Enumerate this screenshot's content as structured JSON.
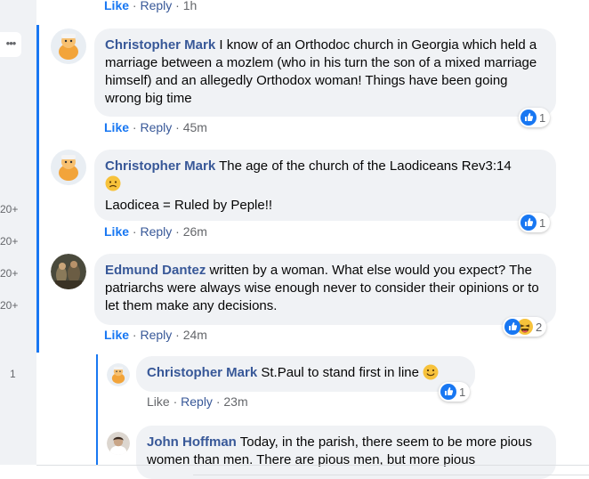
{
  "sidebar": {
    "more_label": "•••",
    "counts": [
      "20+",
      "20+",
      "20+",
      "20+",
      "1"
    ]
  },
  "top_actions": {
    "like": "Like",
    "reply": "Reply",
    "time": "1h"
  },
  "comments": [
    {
      "name": "Christopher Mark",
      "text": "I know of an Orthodoc church in Georgia which held a marriage between a mozlem (who in his turn the son of a mixed marriage himself) and an allegedly Orthodox woman! Things have been going wrong big time",
      "like": "Like",
      "reply": "Reply",
      "time": "45m",
      "reaction_count": "1",
      "reaction_icons": [
        "like-icon"
      ]
    },
    {
      "name": "Christopher Mark",
      "text": "The age of the church of the Laodiceans Rev3:14",
      "text2": "Laodicea = Ruled by Peple!!",
      "emoji": "sad-face-emoji",
      "like": "Like",
      "reply": "Reply",
      "time": "26m",
      "reaction_count": "1",
      "reaction_icons": [
        "like-icon"
      ]
    },
    {
      "name": "Edmund Dantez",
      "text": "written by a woman. What else would you expect? The patriarchs were always wise enough never to consider their opinions or to let them make any decisions.",
      "like": "Like",
      "reply": "Reply",
      "time": "24m",
      "reaction_count": "2",
      "reaction_icons": [
        "like-icon",
        "laugh-icon"
      ]
    }
  ],
  "replies": [
    {
      "name": "Christopher Mark",
      "text": "St.Paul to stand first in line",
      "emoji": "smile-emoji",
      "like": "Like",
      "reply": "Reply",
      "time": "23m",
      "reaction_count": "1",
      "reaction_icons": [
        "like-icon"
      ]
    },
    {
      "name": "John Hoffman",
      "text": "Today, in the parish, there seem to be more pious women than men. There are pious men, but more pious"
    }
  ],
  "colors": {
    "accent": "#1877f2",
    "name": "#385898",
    "bubble": "#f0f2f5",
    "meta": "#65676b"
  }
}
